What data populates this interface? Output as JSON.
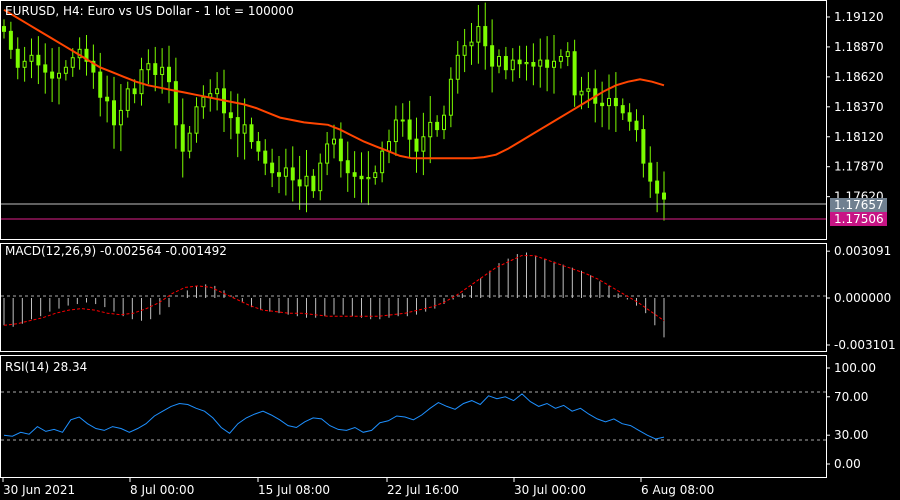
{
  "header": {
    "title": "EURUSD, H4:  Euro vs US Dollar - 1 lot = 100000",
    "macd_label": "MACD(12,26,9) -0.002564 -0.001492",
    "rsi_label": "RSI(14) 28.34"
  },
  "colors": {
    "background": "#000000",
    "border": "#ffffff",
    "candle": "#7cfc00",
    "ma": "#ff4500",
    "macd_hist": "#c0c0c0",
    "macd_signal": "#ff0000",
    "rsi_line": "#1e90ff",
    "bid_line": "#c0c0c0",
    "ask_line": "#e0218a",
    "ask_tag": "#c71585",
    "bid_tag": "#708090"
  },
  "chart_data": [
    {
      "type": "candlestick",
      "symbol": "EURUSD",
      "timeframe": "H4",
      "y_ticks": [
        "1.19120",
        "1.18870",
        "1.18620",
        "1.18370",
        "1.18120",
        "1.17870",
        "1.17620"
      ],
      "ylim": [
        1.173,
        1.1922
      ],
      "bid_label": "1.17657",
      "ask_label": "1.17506",
      "x_ticks": [
        "30 Jun 2021",
        "8 Jul 00:00",
        "15 Jul 08:00",
        "22 Jul 16:00",
        "30 Jul 00:00",
        "6 Aug 08:00"
      ],
      "closes": [
        1.19,
        1.1885,
        1.187,
        1.1875,
        1.188,
        1.1872,
        1.1866,
        1.1861,
        1.1865,
        1.187,
        1.1878,
        1.1885,
        1.1875,
        1.1866,
        1.1845,
        1.1842,
        1.1822,
        1.1834,
        1.1852,
        1.1848,
        1.1868,
        1.1873,
        1.1864,
        1.187,
        1.1858,
        1.1822,
        1.18,
        1.1815,
        1.1837,
        1.1845,
        1.1848,
        1.1852,
        1.1832,
        1.1828,
        1.1815,
        1.1822,
        1.1808,
        1.18,
        1.179,
        1.1782,
        1.1779,
        1.1786,
        1.1776,
        1.1771,
        1.1779,
        1.1767,
        1.179,
        1.1806,
        1.181,
        1.1792,
        1.1782,
        1.1779,
        1.1777,
        1.1778,
        1.1782,
        1.18,
        1.1808,
        1.1826,
        1.1826,
        1.181,
        1.18,
        1.1812,
        1.1824,
        1.1818,
        1.183,
        1.186,
        1.188,
        1.1888,
        1.1891,
        1.1904,
        1.1888,
        1.1871,
        1.1879,
        1.1868,
        1.1876,
        1.1873,
        1.1874,
        1.1871,
        1.1876,
        1.187,
        1.1875,
        1.1879,
        1.1883,
        1.1847,
        1.185,
        1.1852,
        1.184,
        1.1838,
        1.1844,
        1.1838,
        1.1832,
        1.1825,
        1.1818,
        1.179,
        1.1775,
        1.1765,
        1.176
      ],
      "ma": [
        1.1918,
        1.1912,
        1.1906,
        1.19,
        1.1894,
        1.1888,
        1.1882,
        1.1876,
        1.187,
        1.1866,
        1.1862,
        1.1858,
        1.1855,
        1.1853,
        1.1851,
        1.1849,
        1.1847,
        1.1845,
        1.1843,
        1.1841,
        1.1839,
        1.1836,
        1.1832,
        1.1828,
        1.1826,
        1.1824,
        1.1823,
        1.1822,
        1.1818,
        1.1813,
        1.1808,
        1.1804,
        1.18,
        1.1796,
        1.1794,
        1.1794,
        1.1794,
        1.1794,
        1.1794,
        1.1794,
        1.1795,
        1.1797,
        1.1802,
        1.1808,
        1.1814,
        1.182,
        1.1826,
        1.1832,
        1.1838,
        1.1844,
        1.185,
        1.1855,
        1.1858,
        1.186,
        1.1858,
        1.1855
      ],
      "series": [
        {
          "name": "EURUSD"
        }
      ]
    },
    {
      "type": "histogram+line",
      "name": "MACD(12,26,9)",
      "y_ticks": [
        "0.003091",
        "0.000000",
        "-0.003101"
      ],
      "ylim": [
        -0.0033,
        0.0033
      ],
      "histogram": [
        -0.0018,
        -0.0019,
        -0.0017,
        -0.0014,
        -0.0012,
        -0.0009,
        -0.0007,
        -0.0005,
        -0.0004,
        -0.0003,
        -0.0004,
        -0.0006,
        -0.0009,
        -0.0012,
        -0.0014,
        -0.0015,
        -0.0014,
        -0.0011,
        -0.0006,
        0.0,
        0.0005,
        0.0008,
        0.0009,
        0.0008,
        0.0005,
        0.0001,
        -0.0003,
        -0.0006,
        -0.0008,
        -0.0009,
        -0.001,
        -0.0011,
        -0.0012,
        -0.0013,
        -0.0013,
        -0.0012,
        -0.0011,
        -0.0011,
        -0.0012,
        -0.0013,
        -0.0014,
        -0.0014,
        -0.0013,
        -0.0012,
        -0.0012,
        -0.0011,
        -0.0009,
        -0.0007,
        -0.0004,
        -0.0001,
        0.0003,
        0.0008,
        0.0013,
        0.0018,
        0.0023,
        0.0026,
        0.0029,
        0.003,
        0.0028,
        0.0026,
        0.0024,
        0.0022,
        0.002,
        0.0018,
        0.0015,
        0.0011,
        0.0008,
        0.0003,
        -0.0001,
        -0.0005,
        -0.001,
        -0.0018,
        -0.0026
      ],
      "signal": [
        -0.0018,
        -0.0017,
        -0.0015,
        -0.0013,
        -0.001,
        -0.0008,
        -0.0007,
        -0.0008,
        -0.001,
        -0.0011,
        -0.001,
        -0.0007,
        -0.0003,
        0.0003,
        0.0007,
        0.0008,
        0.0007,
        0.0003,
        -0.0001,
        -0.0005,
        -0.0008,
        -0.0009,
        -0.001,
        -0.001,
        -0.0011,
        -0.0012,
        -0.0012,
        -0.0012,
        -0.0012,
        -0.0012,
        -0.0011,
        -0.001,
        -0.0008,
        -0.0006,
        -0.0003,
        0.0002,
        0.0008,
        0.0014,
        0.002,
        0.0024,
        0.0028,
        0.0028,
        0.0025,
        0.0022,
        0.0019,
        0.0016,
        0.0012,
        0.0007,
        0.0002,
        -0.0003,
        -0.0009,
        -0.0015
      ]
    },
    {
      "type": "line",
      "name": "RSI(14)",
      "y_ticks": [
        "100.00",
        "70.00",
        "30.00",
        "0.00"
      ],
      "ylim": [
        0,
        100
      ],
      "levels": [
        70,
        30
      ],
      "values": [
        30,
        29,
        33,
        31,
        39,
        34,
        36,
        33,
        46,
        49,
        42,
        37,
        35,
        39,
        37,
        33,
        37,
        42,
        50,
        55,
        60,
        63,
        62,
        58,
        55,
        48,
        38,
        32,
        42,
        48,
        52,
        55,
        51,
        46,
        40,
        38,
        44,
        48,
        47,
        40,
        36,
        35,
        38,
        33,
        35,
        43,
        45,
        50,
        49,
        46,
        51,
        58,
        64,
        60,
        57,
        63,
        66,
        62,
        71,
        68,
        70,
        66,
        73,
        65,
        60,
        63,
        58,
        61,
        55,
        58,
        52,
        47,
        44,
        47,
        42,
        40,
        35,
        30,
        26,
        28
      ]
    }
  ]
}
